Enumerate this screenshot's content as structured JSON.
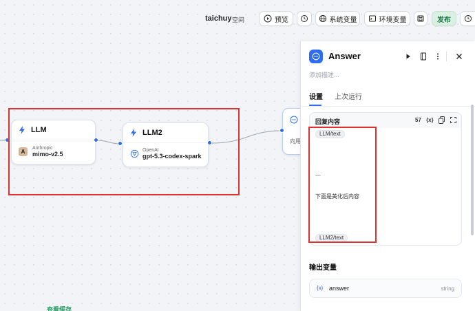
{
  "topbar": {
    "workspace_name": "taichuy",
    "workspace_type": "空间",
    "preview_label": "预览",
    "system_vars_label": "系统变量",
    "env_vars_label": "环境变量",
    "publish_label": "发布"
  },
  "canvas": {
    "nodes": [
      {
        "title": "LLM",
        "provider": "Anthropic",
        "model": "mimo-v2.5"
      },
      {
        "title": "LLM2",
        "provider": "OpenAI",
        "model": "gpt-5.3-codex-spark"
      },
      {
        "title": "",
        "preview": "向用"
      }
    ],
    "bottom_link": "查看缓存"
  },
  "panel": {
    "title": "Answer",
    "description_placeholder": "添加描述...",
    "tabs": [
      {
        "label": "设置",
        "active": true
      },
      {
        "label": "上次运行",
        "active": false
      }
    ],
    "editor": {
      "label": "回复内容",
      "char_count": "57",
      "var_button": "{x}",
      "chip_1": "LLM/text",
      "separator": "---",
      "line": "下面是美化后内容",
      "chip_2": "LLM2/text"
    },
    "output": {
      "section_title": "输出变量",
      "var_icon": "{x}",
      "var_name": "answer",
      "var_type": "string"
    }
  },
  "colors": {
    "accent": "#2e6cf0",
    "highlight": "#e03131",
    "publish": "#1a7a46"
  }
}
